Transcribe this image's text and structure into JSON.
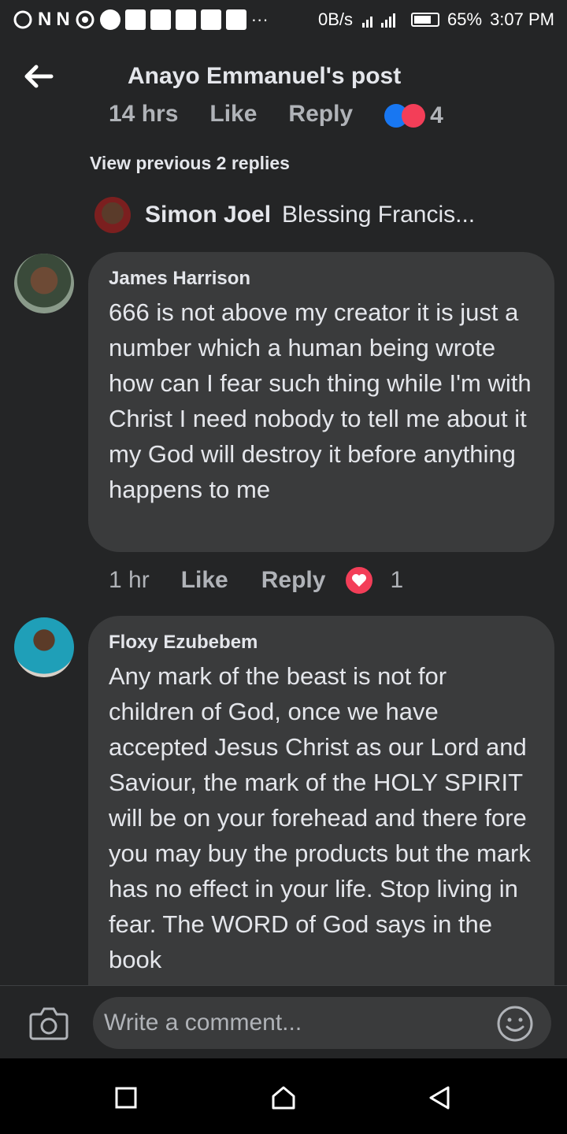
{
  "status_bar": {
    "left_glyphs": [
      "N",
      "N"
    ],
    "net_speed": "0B/s",
    "battery": "65%",
    "time": "3:07 PM",
    "battery_level": 0.65,
    "icons": [
      "notification-icon",
      "ring-icon",
      "notification-icon",
      "notification-icon",
      "notification-icon",
      "notification-icon",
      "more-dots-icon",
      "signal-icon",
      "battery-icon"
    ]
  },
  "header": {
    "title": "Anayo Emmanuel's post",
    "back_icon": "back-arrow-icon"
  },
  "previous_row": {
    "time": "14 hrs",
    "like": "Like",
    "reply": "Reply",
    "reaction_count": "4"
  },
  "view_previous": "View previous 2 replies",
  "reply_preview": {
    "name": "Simon Joel",
    "text": "Blessing Francis..."
  },
  "comments": [
    {
      "author": "James Harrison",
      "text": "666 is  not above my creator it is just a number which a human being wrote how can I fear such thing while I'm with Christ I need nobody to tell me about it my God will destroy it before anything happens to me",
      "time": "1 hr",
      "like": "Like",
      "reply": "Reply",
      "reaction_count": "1",
      "reaction_icon": "heart-icon"
    },
    {
      "author": "Floxy Ezubebem",
      "text": "Any mark of the beast is not for children of God, once we have accepted Jesus Christ as our Lord and Saviour, the mark of the HOLY SPIRIT will be on your forehead and there fore you may buy the products but the mark has no effect in your life. Stop living in fear. The WORD of God says in the book"
    }
  ],
  "composer": {
    "placeholder": "Write a comment...",
    "value": "",
    "camera_icon": "camera-icon",
    "emoji_icon": "emoji-icon"
  },
  "nav": {
    "icons": [
      "recent-apps-icon",
      "home-icon",
      "back-icon"
    ]
  },
  "colors": {
    "background": "#242526",
    "bubble": "#3a3b3c",
    "text": "#e4e6eb",
    "secondary_text": "#b0b3b8",
    "heart": "#f33e58",
    "like_blue": "#1877f2"
  }
}
